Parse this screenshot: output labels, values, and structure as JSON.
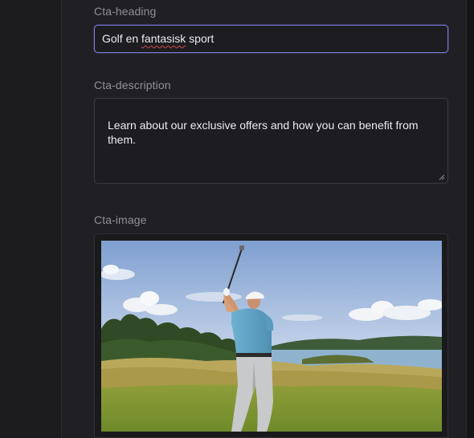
{
  "fields": {
    "heading": {
      "label": "Cta-heading",
      "value_before": "Golf en ",
      "value_misspelled": "fantasisk",
      "value_after": " sport"
    },
    "description": {
      "label": "Cta-description",
      "value": "Learn about our exclusive offers and how you can benefit from them."
    },
    "image": {
      "label": "Cta-image",
      "subject": "golfer-swinging-on-course-photo"
    }
  },
  "colors": {
    "background": "#1b1b1e",
    "panel": "#202024",
    "input_focus_border": "#7b78d6",
    "label": "#8f8f97",
    "text": "#ececf0"
  }
}
